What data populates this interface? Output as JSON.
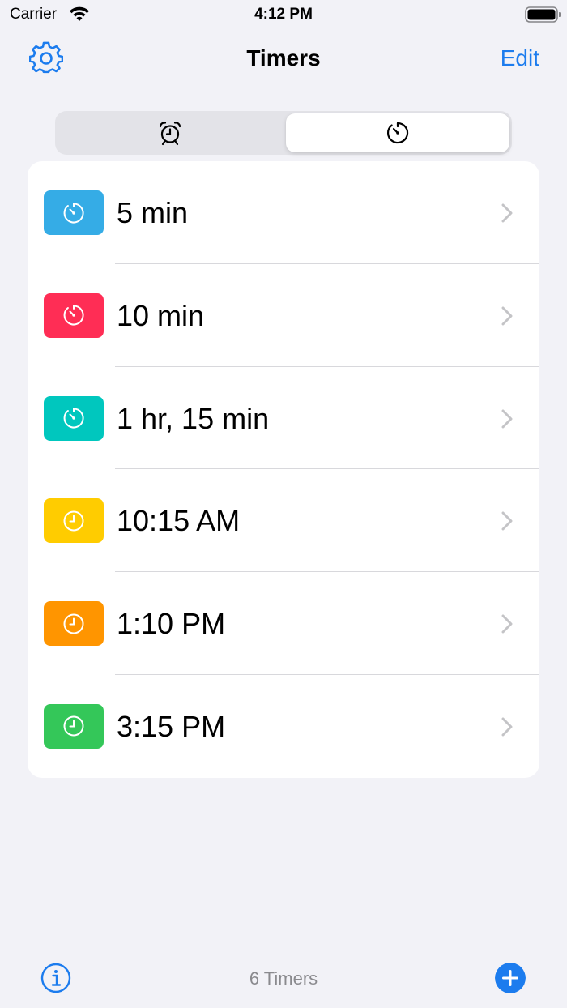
{
  "status_bar": {
    "carrier": "Carrier",
    "time": "4:12 PM"
  },
  "nav": {
    "title": "Timers",
    "edit_label": "Edit",
    "settings_icon": "gear-icon",
    "accent_color": "#1C7CEE"
  },
  "segmented": {
    "segments": [
      {
        "icon": "alarm-clock-icon",
        "selected": false
      },
      {
        "icon": "timer-icon",
        "selected": true
      }
    ]
  },
  "timers": [
    {
      "label": "5 min",
      "icon": "timer-icon",
      "color": "#35ACE6"
    },
    {
      "label": "10 min",
      "icon": "timer-icon",
      "color": "#FF2D55"
    },
    {
      "label": "1 hr, 15 min",
      "icon": "timer-icon",
      "color": "#00C7BE"
    },
    {
      "label": "10:15 AM",
      "icon": "clock-icon",
      "color": "#FFCC00"
    },
    {
      "label": "1:10 PM",
      "icon": "clock-icon",
      "color": "#FF9500"
    },
    {
      "label": "3:15 PM",
      "icon": "clock-icon",
      "color": "#34C759"
    }
  ],
  "toolbar": {
    "count_text": "6 Timers",
    "info_icon": "info-icon",
    "add_icon": "plus-icon"
  }
}
